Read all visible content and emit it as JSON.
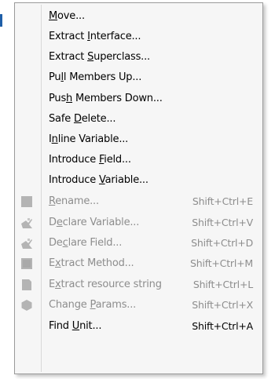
{
  "menu": {
    "items": [
      {
        "label": "Move...",
        "pre": "",
        "key": "M",
        "post": "ove...",
        "shortcut": "",
        "enabled": true,
        "icon": ""
      },
      {
        "label": "Extract Interface...",
        "pre": "Extract ",
        "key": "I",
        "post": "nterface...",
        "shortcut": "",
        "enabled": true,
        "icon": ""
      },
      {
        "label": "Extract Superclass...",
        "pre": "Extract ",
        "key": "S",
        "post": "uperclass...",
        "shortcut": "",
        "enabled": true,
        "icon": ""
      },
      {
        "label": "Pull Members Up...",
        "pre": "Pu",
        "key": "l",
        "post": "l Members Up...",
        "shortcut": "",
        "enabled": true,
        "icon": ""
      },
      {
        "label": "Push Members Down...",
        "pre": "Pus",
        "key": "h",
        "post": " Members Down...",
        "shortcut": "",
        "enabled": true,
        "icon": ""
      },
      {
        "label": "Safe Delete...",
        "pre": "Safe ",
        "key": "D",
        "post": "elete...",
        "shortcut": "",
        "enabled": true,
        "icon": ""
      },
      {
        "label": "Inline Variable...",
        "pre": "I",
        "key": "n",
        "post": "line Variable...",
        "shortcut": "",
        "enabled": true,
        "icon": ""
      },
      {
        "label": "Introduce Field...",
        "pre": "Introduce ",
        "key": "F",
        "post": "ield...",
        "shortcut": "",
        "enabled": true,
        "icon": ""
      },
      {
        "label": "Introduce Variable...",
        "pre": "Introduce ",
        "key": "V",
        "post": "ariable...",
        "shortcut": "",
        "enabled": true,
        "icon": ""
      },
      {
        "label": "Rename...",
        "pre": "",
        "key": "R",
        "post": "ename...",
        "shortcut": "Shift+Ctrl+E",
        "enabled": false,
        "icon": "rename-icon"
      },
      {
        "label": "Declare Variable...",
        "pre": "D",
        "key": "e",
        "post": "clare Variable...",
        "shortcut": "Shift+Ctrl+V",
        "enabled": false,
        "icon": "declare-variable-icon"
      },
      {
        "label": "Declare Field...",
        "pre": "De",
        "key": "c",
        "post": "lare Field...",
        "shortcut": "Shift+Ctrl+D",
        "enabled": false,
        "icon": "declare-field-icon"
      },
      {
        "label": "Extract Method...",
        "pre": "E",
        "key": "x",
        "post": "tract Method...",
        "shortcut": "Shift+Ctrl+M",
        "enabled": false,
        "icon": "extract-method-icon"
      },
      {
        "label": "Extract resource string",
        "pre": "E",
        "key": "x",
        "post": "tract resource string",
        "shortcut": "Shift+Ctrl+L",
        "enabled": false,
        "icon": "extract-resource-string-icon"
      },
      {
        "label": "Change Params...",
        "pre": "Change ",
        "key": "P",
        "post": "arams...",
        "shortcut": "Shift+Ctrl+X",
        "enabled": false,
        "icon": "change-params-icon"
      },
      {
        "label": "Find Unit...",
        "pre": "Find ",
        "key": "U",
        "post": "nit...",
        "shortcut": "Shift+Ctrl+A",
        "enabled": true,
        "icon": ""
      }
    ]
  },
  "colors": {
    "menu_bg": "#f6f6f6",
    "border": "#9a9a9a",
    "text": "#000000",
    "disabled_text": "#8d8d8d",
    "disabled_icon": "#b4b4b4"
  }
}
